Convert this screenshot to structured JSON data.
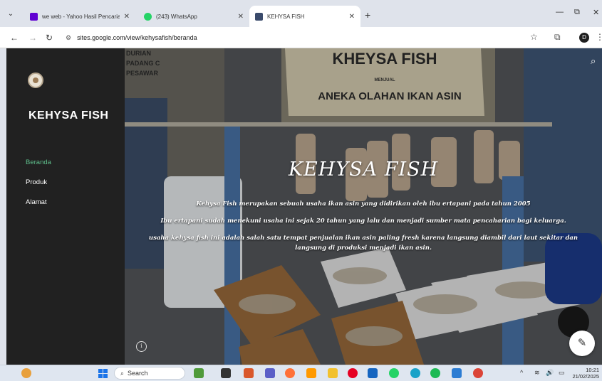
{
  "browser": {
    "tabs": [
      {
        "title": "we web - Yahoo Hasil Pencarian",
        "favicon_color": "#6001d2",
        "active": false
      },
      {
        "title": "(243) WhatsApp",
        "favicon_color": "#25d366",
        "active": false
      },
      {
        "title": "KEHYSA FISH",
        "favicon_color": "#3a4a6b",
        "active": true
      }
    ],
    "new_tab": "+",
    "window_controls": {
      "minimize": "—",
      "restore": "⧉",
      "close": "✕"
    },
    "url": "sites.google.com/view/kehysafish/beranda",
    "profile_initial": "D"
  },
  "site": {
    "title": "KEHYSA FISH",
    "nav": [
      {
        "label": "Beranda",
        "active": true
      },
      {
        "label": "Produk",
        "active": false
      },
      {
        "label": "Alamat",
        "active": false
      }
    ],
    "hero": {
      "heading": "KEHYSA FISH",
      "paragraphs": [
        "Kehysa Fish merupakan sebuah usaha  ikan asin yang didirikan oleh ibu ertapani pada tahun 2005",
        "Ibu ertapani sudah menekuni usaha ini sejak 20 tahun yang lalu dan menjadi sumber mata pencaharian bagi keluarga.",
        "usaha kehysa fish ini adalah salah satu tempat penjualan ikan asin paling fresh karena langsung diambil dari laut sekitar dan",
        "langsung di produksi menjadi ikan asin."
      ],
      "photo_signs": [
        "KHEYSA FISH",
        "MENJUAL",
        "ANEKA OLAHAN IKAN ASIN",
        "DURIAN",
        "PADANG C",
        "PESAWAR"
      ]
    }
  },
  "taskbar": {
    "search_placeholder": "Search",
    "clock_time": "10:21",
    "clock_date": "21/02/2025",
    "tray": {
      "chevron": "^",
      "wifi": "≋",
      "volume": "🔊",
      "battery": "▭"
    }
  }
}
